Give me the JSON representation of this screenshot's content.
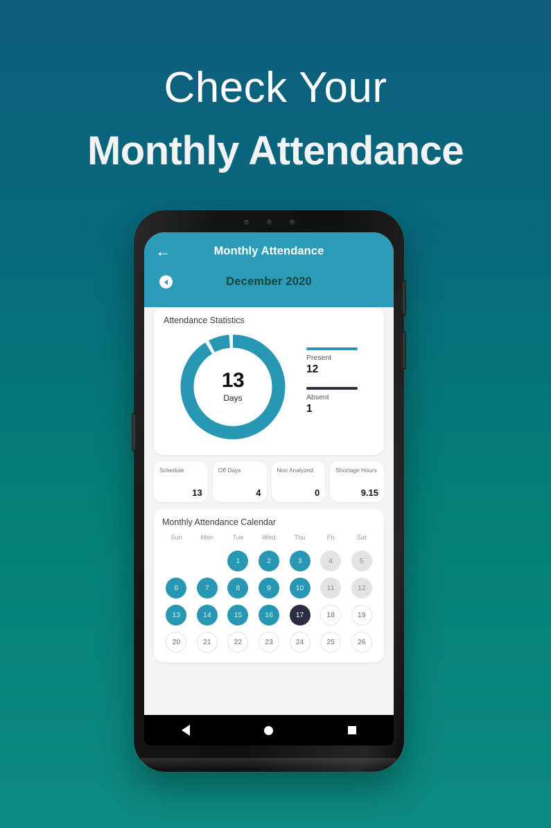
{
  "promo": {
    "line1": "Check Your",
    "line2": "Monthly Attendance"
  },
  "colors": {
    "bg_top": "#0f5d7d",
    "bg_bottom": "#0d8a83",
    "header_teal": "#2c9cb9",
    "accent_teal": "#2897b3",
    "today_navy": "#2b2e43",
    "off_grey": "#e3e3e3"
  },
  "app": {
    "header": {
      "back_icon": "arrow-left-icon",
      "title": "Monthly Attendance",
      "prev_month_icon": "chevron-left-icon",
      "month_label": "December 2020"
    },
    "stats_card": {
      "title": "Attendance Statistics",
      "donut_value": "13",
      "donut_label": "Days",
      "legend": [
        {
          "name": "Present",
          "value": "12",
          "color": "#2897b3"
        },
        {
          "name": "Absent",
          "value": "1",
          "color": "#2b2e43"
        }
      ]
    },
    "tiles": [
      {
        "label": "Schedule",
        "value": "13"
      },
      {
        "label": "Off Days",
        "value": "4"
      },
      {
        "label": "Non Analyzed",
        "value": "0"
      },
      {
        "label": "Shortage Hours",
        "value": "9.15"
      }
    ],
    "calendar": {
      "title": "Monthly Attendance Calendar",
      "dow": [
        "Sun",
        "Mon",
        "Tue",
        "Wed",
        "Thu",
        "Fri",
        "Sat"
      ],
      "days": [
        {
          "n": "",
          "state": "empty"
        },
        {
          "n": "",
          "state": "empty"
        },
        {
          "n": "1",
          "state": "present"
        },
        {
          "n": "2",
          "state": "present"
        },
        {
          "n": "3",
          "state": "present"
        },
        {
          "n": "4",
          "state": "off"
        },
        {
          "n": "5",
          "state": "off"
        },
        {
          "n": "6",
          "state": "present"
        },
        {
          "n": "7",
          "state": "present"
        },
        {
          "n": "8",
          "state": "present"
        },
        {
          "n": "9",
          "state": "present"
        },
        {
          "n": "10",
          "state": "present"
        },
        {
          "n": "11",
          "state": "off"
        },
        {
          "n": "12",
          "state": "off"
        },
        {
          "n": "13",
          "state": "present"
        },
        {
          "n": "14",
          "state": "present"
        },
        {
          "n": "15",
          "state": "present"
        },
        {
          "n": "16",
          "state": "present"
        },
        {
          "n": "17",
          "state": "today"
        },
        {
          "n": "18",
          "state": "plain"
        },
        {
          "n": "19",
          "state": "plain"
        },
        {
          "n": "20",
          "state": "plain"
        },
        {
          "n": "21",
          "state": "plain"
        },
        {
          "n": "22",
          "state": "plain"
        },
        {
          "n": "23",
          "state": "plain"
        },
        {
          "n": "24",
          "state": "plain"
        },
        {
          "n": "25",
          "state": "plain"
        },
        {
          "n": "26",
          "state": "plain"
        }
      ]
    },
    "android_nav": {
      "back": "triangle-back-icon",
      "home": "circle-home-icon",
      "recents": "square-recents-icon"
    }
  },
  "chart_data": {
    "type": "pie",
    "title": "Attendance Statistics",
    "categories": [
      "Present",
      "Absent"
    ],
    "values": [
      12,
      1
    ],
    "total": 13,
    "center_value": "13",
    "center_label": "Days",
    "colors": [
      "#2897b3",
      "#2897b3"
    ],
    "legend_position": "right",
    "donut": true
  }
}
